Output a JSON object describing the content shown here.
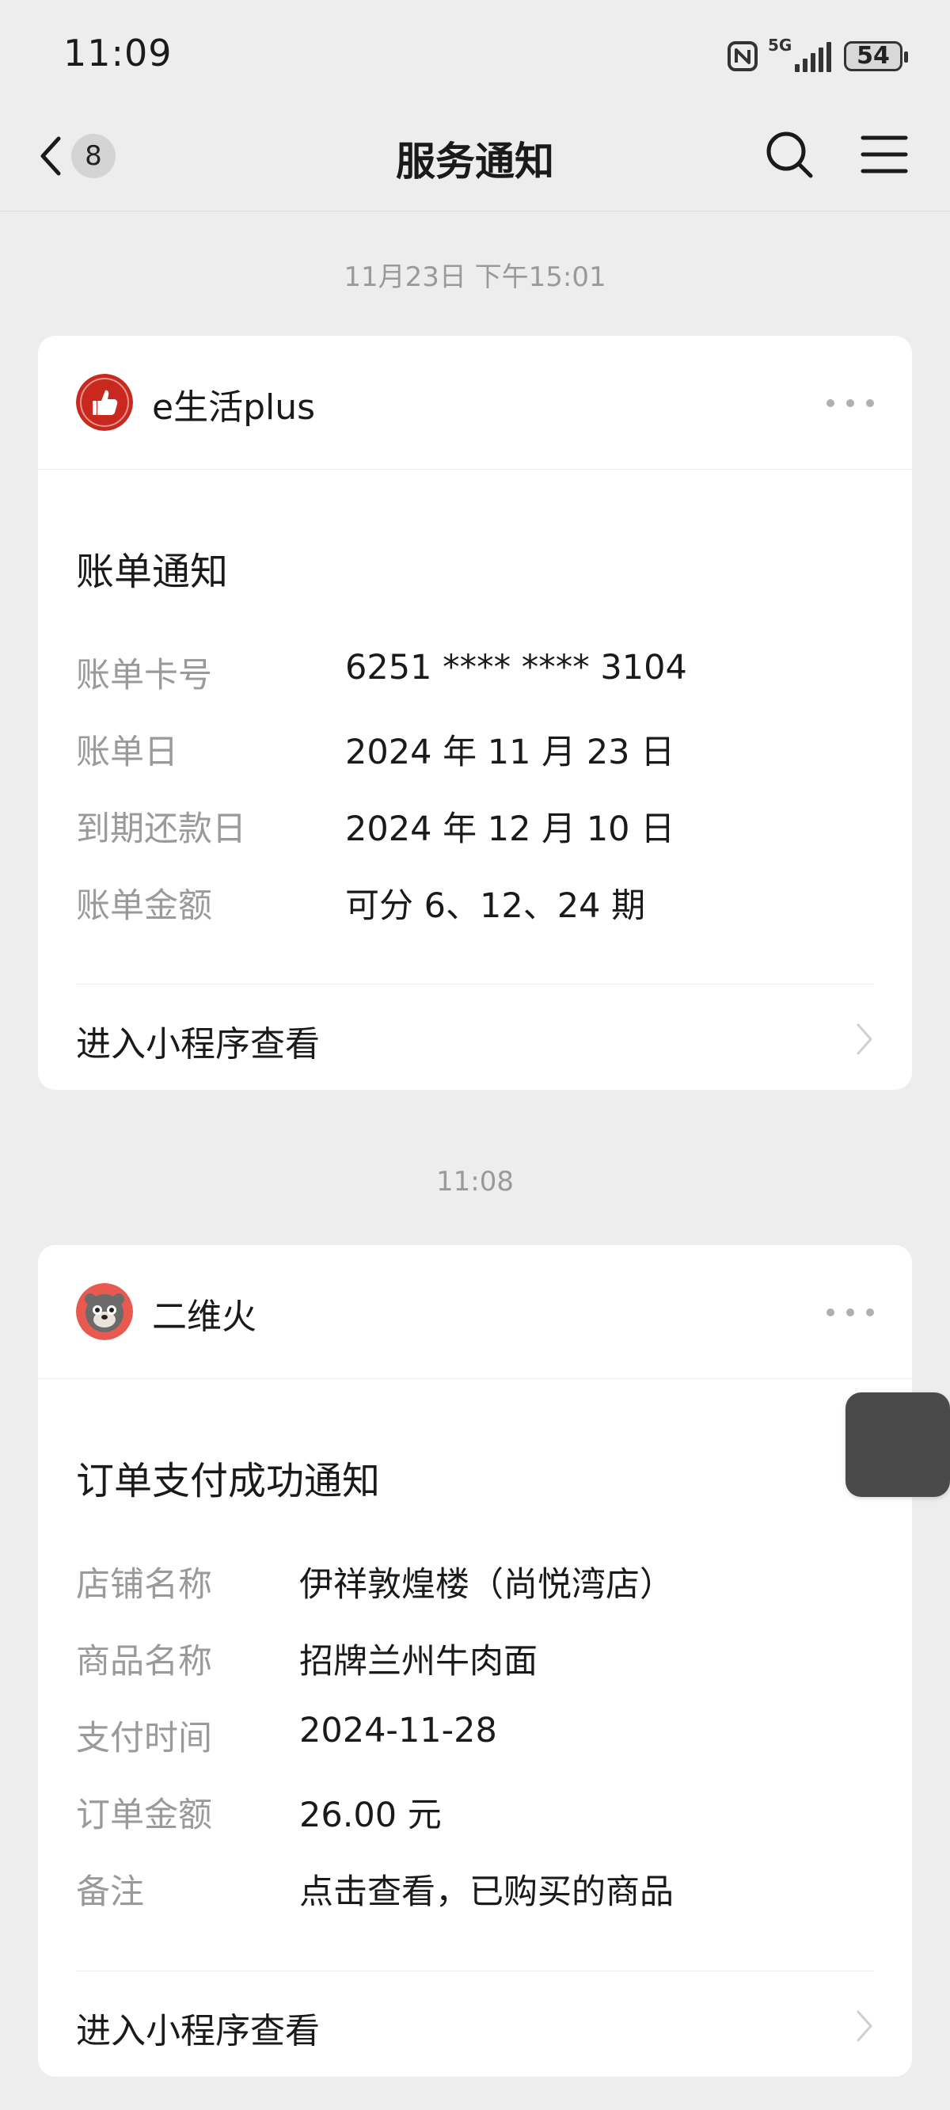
{
  "status_bar": {
    "time": "11:09",
    "network": "5G",
    "battery": "54",
    "icons": [
      "nfc-icon",
      "signal-icon",
      "battery-icon"
    ]
  },
  "nav": {
    "title": "服务通知",
    "back_badge": "8",
    "icons": [
      "chevron-left-icon",
      "search-icon",
      "menu-icon"
    ]
  },
  "messages": [
    {
      "timestamp": "11月23日 下午15:01",
      "sender": "e生活plus",
      "avatar_icon": "thumbs-up-icon",
      "avatar_color": "#c8281e",
      "title": "账单通知",
      "fields": [
        {
          "label": "账单卡号",
          "value": "6251 **** **** 3104"
        },
        {
          "label": "账单日",
          "value": "2024 年 11 月 23 日"
        },
        {
          "label": "到期还款日",
          "value": "2024 年 12 月 10 日"
        },
        {
          "label": "账单金额",
          "value": "可分 6、12、24 期"
        }
      ],
      "link_label": "进入小程序查看"
    },
    {
      "timestamp": "11:08",
      "sender": "二维火",
      "avatar_icon": "bear-mascot-icon",
      "avatar_color": "#e85a4f",
      "title": "订单支付成功通知",
      "fields": [
        {
          "label": "店铺名称",
          "value": "伊祥敦煌楼（尚悦湾店）"
        },
        {
          "label": "商品名称",
          "value": "招牌兰州牛肉面"
        },
        {
          "label": "支付时间",
          "value": "2024-11-28"
        },
        {
          "label": "订单金额",
          "value": "26.00 元"
        },
        {
          "label": "备注",
          "value": "点击查看，已购买的商品"
        }
      ],
      "link_label": "进入小程序查看"
    }
  ]
}
